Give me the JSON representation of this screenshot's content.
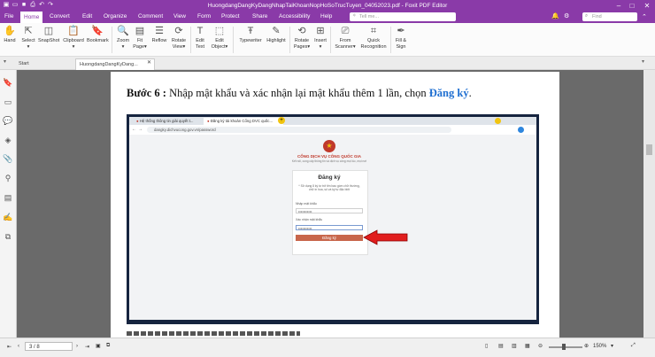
{
  "window": {
    "title": "HuongdangDangKyDangNhapTaiKhoanNopHoSoTrucTuyen_04052023.pdf - Foxit PDF Editor"
  },
  "menu": {
    "items": [
      "File",
      "Home",
      "Convert",
      "Edit",
      "Organize",
      "Comment",
      "View",
      "Form",
      "Protect",
      "Share",
      "Accessibility",
      "Help"
    ],
    "active": "Home",
    "tell_me_placeholder": "Tell me...",
    "find_placeholder": "Find"
  },
  "ribbon": {
    "tools": [
      {
        "label": "Hand"
      },
      {
        "label": "Select",
        "sub": "▾"
      },
      {
        "label": "SnapShot"
      },
      {
        "label": "Clipboard",
        "sub": "▾"
      },
      {
        "label": "Bookmark"
      },
      {
        "label": "Zoom",
        "sub": "▾"
      },
      {
        "label": "Fit",
        "sub": "Page▾"
      },
      {
        "label": "Reflow"
      },
      {
        "label": "Rotate",
        "sub": "View▾"
      },
      {
        "label": "Edit",
        "sub": "Text"
      },
      {
        "label": "Edit",
        "sub": "Object▾"
      },
      {
        "label": "Typewriter"
      },
      {
        "label": "Highlight"
      },
      {
        "label": "Rotate",
        "sub": "Pages▾"
      },
      {
        "label": "Insert",
        "sub": "▾"
      },
      {
        "label": "From",
        "sub": "Scanner▾"
      },
      {
        "label": "Quick",
        "sub": "Recognition"
      },
      {
        "label": "Fill &",
        "sub": "Sign"
      }
    ]
  },
  "tabs": {
    "start": "Start",
    "doc": "HuongdangDangKyDang..."
  },
  "document": {
    "step_label": "Bước 6 :",
    "step_text": " Nhập mật khẩu và xác nhận lại mật khẩu thêm 1 lần, chọn ",
    "step_link": "Đăng ký",
    "step_end": "."
  },
  "screenshot": {
    "tab1": "Hệ thống thông tin giải quyết t...",
    "tab2": "Đăng ký tài khoản Cổng DVC quốc...",
    "url": "dangky.dichvucong.gov.vn/password",
    "portal_title": "CỔNG DỊCH VỤ CÔNG QUỐC GIA",
    "portal_subtitle": "Kết nối, cung cấp thông tin và dịch vụ công mọi lúc, mọi nơi",
    "form_title": "Đăng ký",
    "form_hint": "* Sử dụng 8 ký tự trở lên bao gồm chữ thường, chữ in hoa, số và ký tự đặc biệt",
    "password_label": "Nhập mật khẩu",
    "password_value": "•••••••••••",
    "confirm_label": "Xác nhận mật khẩu",
    "confirm_value": "•••••••••••",
    "submit_label": "Đăng ký"
  },
  "status": {
    "page_indicator": "3 / 8",
    "zoom": "150%"
  },
  "colors": {
    "brand": "#8a3aa8",
    "link": "#1f6fd1",
    "arrow": "#e11d1d",
    "submit": "#c8664b"
  }
}
